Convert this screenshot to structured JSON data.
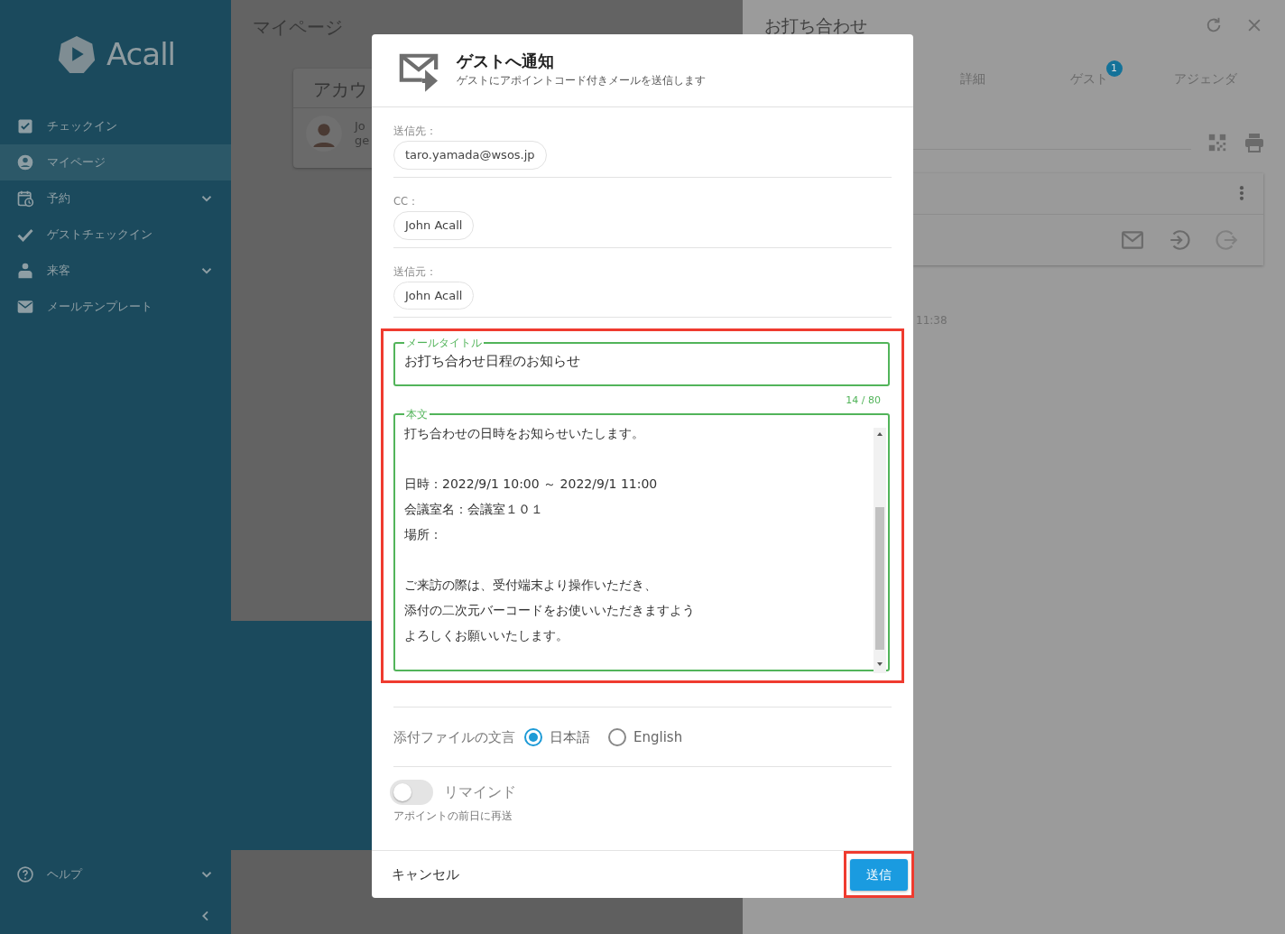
{
  "sidebar": {
    "logo": "Acall",
    "items": [
      {
        "label": "チェックイン",
        "kind": "link",
        "selected": false
      },
      {
        "label": "マイページ",
        "kind": "link",
        "selected": true
      },
      {
        "label": "予約",
        "kind": "group",
        "selected": false
      },
      {
        "label": "ゲストチェックイン",
        "kind": "link",
        "selected": false
      },
      {
        "label": "来客",
        "kind": "group",
        "selected": false
      },
      {
        "label": "メールテンプレート",
        "kind": "link",
        "selected": false
      }
    ],
    "footer_items": [
      {
        "label": "ヘルプ",
        "kind": "group",
        "selected": false
      }
    ]
  },
  "page": {
    "title": "マイページ",
    "card": {
      "heading": "アカウ",
      "name": "Jo",
      "subtitle": "ge"
    }
  },
  "side_panel": {
    "title": "お打ち合わせ",
    "tabs": [
      {
        "label": "詳細",
        "selected": false
      },
      {
        "label": "ゲスト",
        "selected": false,
        "badge": "1"
      },
      {
        "label": "アジェンダ",
        "selected": false
      }
    ],
    "time": "11:38"
  },
  "dialog": {
    "title": "ゲストへ通知",
    "subtitle": "ゲストにアポイントコード付きメールを送信します",
    "recipients": [
      {
        "label": "送信先：",
        "chips": [
          "taro.yamada@wsos.jp"
        ]
      },
      {
        "label": "CC：",
        "chips": [
          "John Acall"
        ]
      },
      {
        "label": "送信元：",
        "chips": [
          "John Acall"
        ]
      }
    ],
    "subject": {
      "legend": "メールタイトル",
      "value": "お打ち合わせ日程のお知らせ",
      "counter": "14 / 80"
    },
    "body": {
      "legend": "本文",
      "paragraphs": [
        [
          "打ち合わせの日時をお知らせいたします。"
        ],
        [
          "日時：2022/9/1 10:00 ～ 2022/9/1 11:00",
          "会議室名：会議室１０１",
          "場所："
        ],
        [
          "ご来訪の際は、受付端末より操作いただき、",
          "添付の二次元バーコードをお使いいただきますよう",
          "よろしくお願いいたします。"
        ]
      ]
    },
    "attachment_language": {
      "label": "添付ファイルの文言",
      "options": [
        {
          "label": "日本語",
          "selected": true
        },
        {
          "label": "English",
          "selected": false
        }
      ]
    },
    "remind": {
      "label": "リマインド",
      "on": false,
      "hint": "アポイントの前日に再送"
    },
    "cancel_button": "キャンセル",
    "send_button": "送信"
  }
}
